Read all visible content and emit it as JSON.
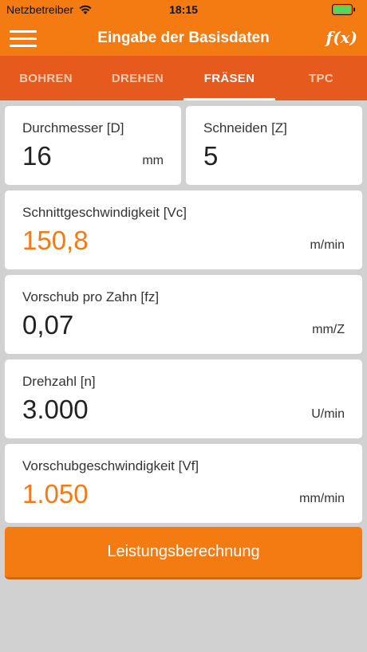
{
  "status_bar": {
    "carrier": "Netzbetreiber",
    "time": "18:15"
  },
  "nav": {
    "title": "Eingabe der Basisdaten",
    "fx_label": "f(x)"
  },
  "tabs": [
    {
      "label": "BOHREN",
      "active": false
    },
    {
      "label": "DREHEN",
      "active": false
    },
    {
      "label": "FRÄSEN",
      "active": true
    },
    {
      "label": "TPC",
      "active": false
    }
  ],
  "fields": {
    "diameter": {
      "label": "Durchmesser [D]",
      "value": "16",
      "unit": "mm"
    },
    "cutters": {
      "label": "Schneiden [Z]",
      "value": "5",
      "unit": ""
    },
    "cutting_speed": {
      "label": "Schnittgeschwindigkeit [Vc]",
      "value": "150,8",
      "unit": "m/min"
    },
    "feed_per_tooth": {
      "label": "Vorschub pro Zahn [fz]",
      "value": "0,07",
      "unit": "mm/Z"
    },
    "speed": {
      "label": "Drehzahl [n]",
      "value": "3.000",
      "unit": "U/min"
    },
    "feed_rate": {
      "label": "Vorschubgeschwindigkeit [Vf]",
      "value": "1.050",
      "unit": "mm/min"
    }
  },
  "actions": {
    "calculate_label": "Leistungsberechnung"
  },
  "colors": {
    "primary": "#f47a12",
    "tab_bar": "#e65a1e",
    "background": "#d1d1d1"
  }
}
